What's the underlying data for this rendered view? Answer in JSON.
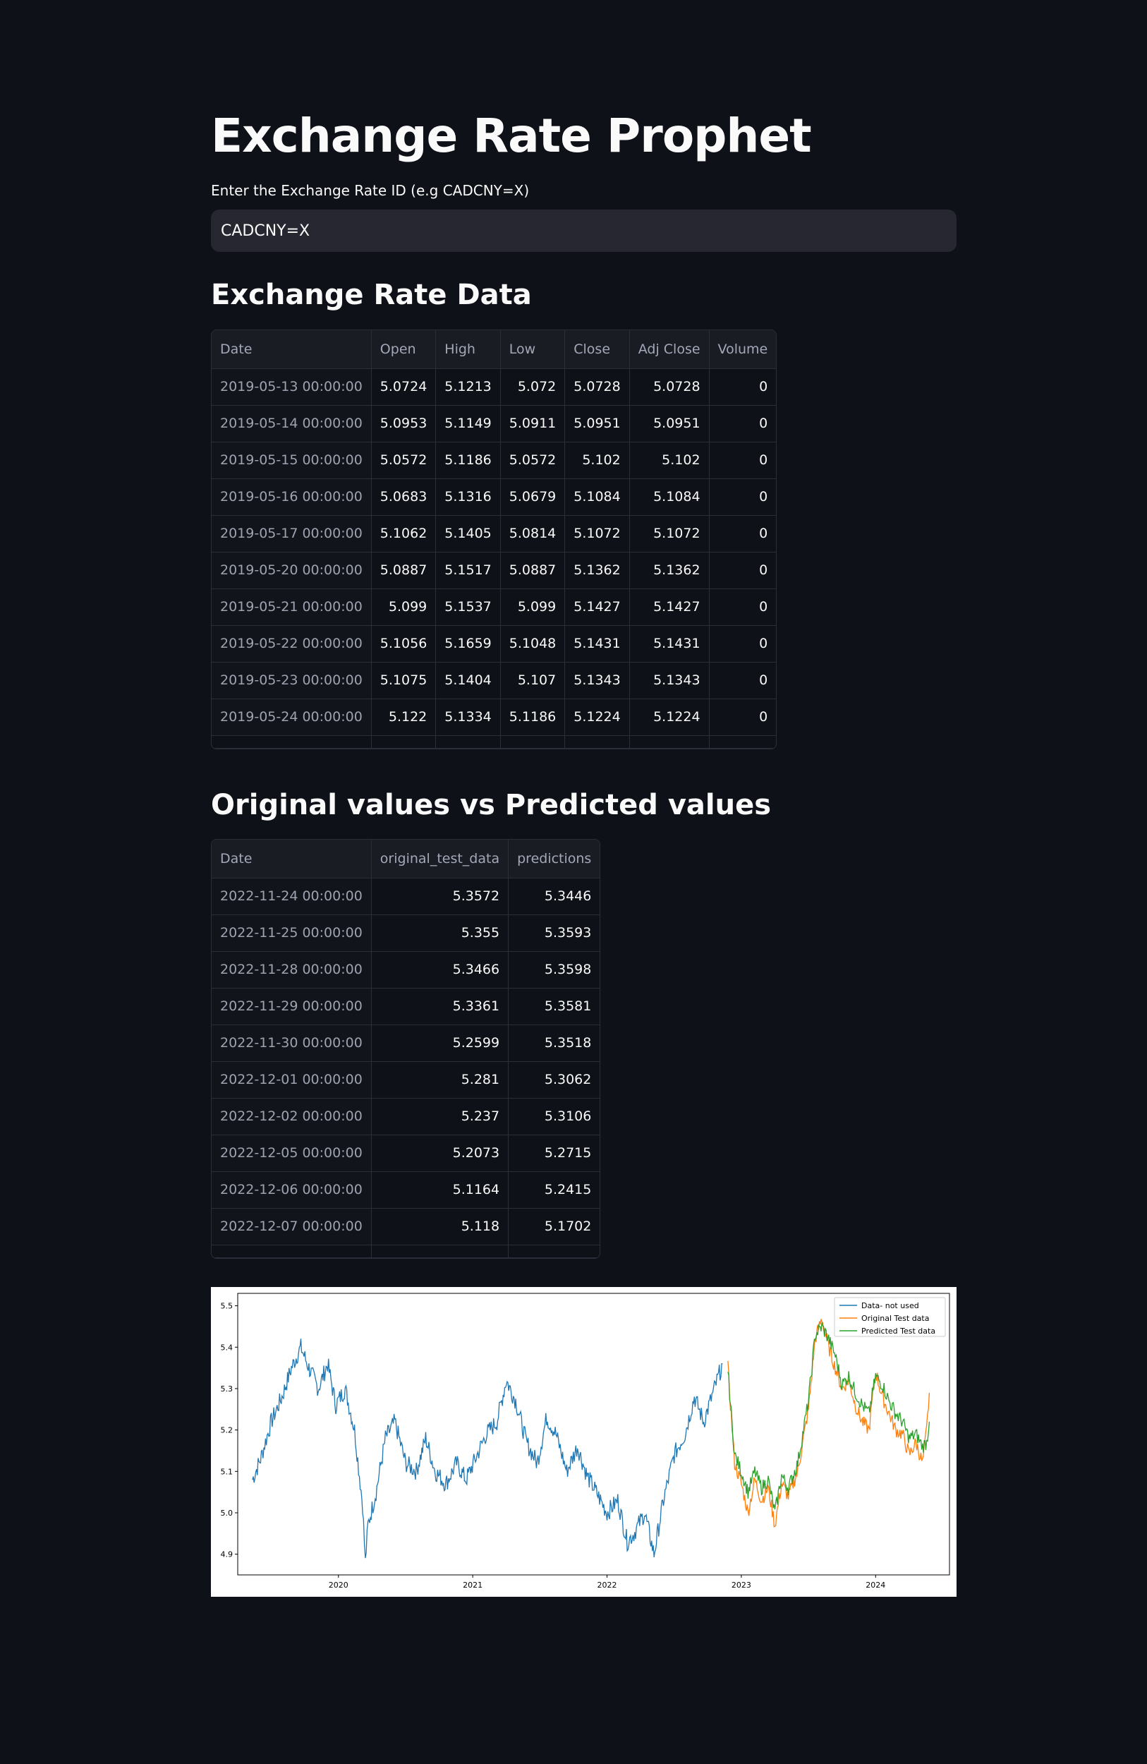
{
  "app": {
    "title": "Exchange Rate Prophet",
    "input_label": "Enter the Exchange Rate ID (e.g CADCNY=X)",
    "input_value": "CADCNY=X"
  },
  "exchange_section": {
    "heading": "Exchange Rate Data",
    "columns": [
      "Date",
      "Open",
      "High",
      "Low",
      "Close",
      "Adj Close",
      "Volume"
    ],
    "rows": [
      [
        "2019-05-13 00:00:00",
        "5.0724",
        "5.1213",
        "5.072",
        "5.0728",
        "5.0728",
        "0"
      ],
      [
        "2019-05-14 00:00:00",
        "5.0953",
        "5.1149",
        "5.0911",
        "5.0951",
        "5.0951",
        "0"
      ],
      [
        "2019-05-15 00:00:00",
        "5.0572",
        "5.1186",
        "5.0572",
        "5.102",
        "5.102",
        "0"
      ],
      [
        "2019-05-16 00:00:00",
        "5.0683",
        "5.1316",
        "5.0679",
        "5.1084",
        "5.1084",
        "0"
      ],
      [
        "2019-05-17 00:00:00",
        "5.1062",
        "5.1405",
        "5.0814",
        "5.1072",
        "5.1072",
        "0"
      ],
      [
        "2019-05-20 00:00:00",
        "5.0887",
        "5.1517",
        "5.0887",
        "5.1362",
        "5.1362",
        "0"
      ],
      [
        "2019-05-21 00:00:00",
        "5.099",
        "5.1537",
        "5.099",
        "5.1427",
        "5.1427",
        "0"
      ],
      [
        "2019-05-22 00:00:00",
        "5.1056",
        "5.1659",
        "5.1048",
        "5.1431",
        "5.1431",
        "0"
      ],
      [
        "2019-05-23 00:00:00",
        "5.1075",
        "5.1404",
        "5.107",
        "5.1343",
        "5.1343",
        "0"
      ],
      [
        "2019-05-24 00:00:00",
        "5.122",
        "5.1334",
        "5.1186",
        "5.1224",
        "5.1224",
        "0"
      ]
    ]
  },
  "prediction_section": {
    "heading": "Original values vs Predicted values",
    "columns": [
      "Date",
      "original_test_data",
      "predictions"
    ],
    "rows": [
      [
        "2022-11-24 00:00:00",
        "5.3572",
        "5.3446"
      ],
      [
        "2022-11-25 00:00:00",
        "5.355",
        "5.3593"
      ],
      [
        "2022-11-28 00:00:00",
        "5.3466",
        "5.3598"
      ],
      [
        "2022-11-29 00:00:00",
        "5.3361",
        "5.3581"
      ],
      [
        "2022-11-30 00:00:00",
        "5.2599",
        "5.3518"
      ],
      [
        "2022-12-01 00:00:00",
        "5.281",
        "5.3062"
      ],
      [
        "2022-12-02 00:00:00",
        "5.237",
        "5.3106"
      ],
      [
        "2022-12-05 00:00:00",
        "5.2073",
        "5.2715"
      ],
      [
        "2022-12-06 00:00:00",
        "5.1164",
        "5.2415"
      ],
      [
        "2022-12-07 00:00:00",
        "5.118",
        "5.1702"
      ]
    ]
  },
  "chart_data": {
    "type": "line",
    "title": "",
    "xlabel": "",
    "ylabel": "",
    "x_ticks": [
      "2020",
      "2021",
      "2022",
      "2023",
      "2024"
    ],
    "y_ticks": [
      "4.9",
      "5.0",
      "5.1",
      "5.2",
      "5.3",
      "5.4",
      "5.5"
    ],
    "xlim": [
      2019.25,
      2024.55
    ],
    "ylim": [
      4.85,
      5.53
    ],
    "grid": false,
    "legend_position": "top-right",
    "series": [
      {
        "name": "Data- not used",
        "color": "#1f77b4",
        "x": [
          2019.36,
          2019.42,
          2019.5,
          2019.58,
          2019.65,
          2019.72,
          2019.78,
          2019.85,
          2019.92,
          2019.98,
          2020.05,
          2020.12,
          2020.18,
          2020.2,
          2020.22,
          2020.28,
          2020.35,
          2020.42,
          2020.5,
          2020.58,
          2020.65,
          2020.72,
          2020.8,
          2020.88,
          2020.95,
          2021.02,
          2021.1,
          2021.18,
          2021.25,
          2021.32,
          2021.4,
          2021.48,
          2021.55,
          2021.62,
          2021.7,
          2021.78,
          2021.85,
          2021.92,
          2022.0,
          2022.08,
          2022.15,
          2022.2,
          2022.28,
          2022.35,
          2022.42,
          2022.5,
          2022.58,
          2022.65,
          2022.72,
          2022.8,
          2022.86
        ],
        "y": [
          5.08,
          5.13,
          5.22,
          5.28,
          5.35,
          5.4,
          5.35,
          5.3,
          5.36,
          5.26,
          5.3,
          5.2,
          5.02,
          4.88,
          4.97,
          5.05,
          5.18,
          5.22,
          5.12,
          5.1,
          5.18,
          5.1,
          5.07,
          5.12,
          5.08,
          5.13,
          5.19,
          5.22,
          5.32,
          5.27,
          5.17,
          5.12,
          5.23,
          5.19,
          5.1,
          5.16,
          5.09,
          5.05,
          5.0,
          5.03,
          4.93,
          4.95,
          5.0,
          4.9,
          5.03,
          5.14,
          5.19,
          5.28,
          5.22,
          5.3,
          5.36
        ]
      },
      {
        "name": "Original Test data",
        "color": "#ff7f0e",
        "x": [
          2022.9,
          2022.95,
          2023.0,
          2023.05,
          2023.1,
          2023.15,
          2023.2,
          2023.25,
          2023.3,
          2023.35,
          2023.42,
          2023.5,
          2023.55,
          2023.6,
          2023.65,
          2023.7,
          2023.75,
          2023.8,
          2023.85,
          2023.9,
          2023.95,
          2024.0,
          2024.05,
          2024.1,
          2024.15,
          2024.2,
          2024.25,
          2024.3,
          2024.35,
          2024.38,
          2024.4
        ],
        "y": [
          5.35,
          5.12,
          5.07,
          5.0,
          5.08,
          5.03,
          5.06,
          4.97,
          5.07,
          5.04,
          5.1,
          5.25,
          5.42,
          5.47,
          5.4,
          5.35,
          5.3,
          5.32,
          5.26,
          5.22,
          5.2,
          5.34,
          5.28,
          5.24,
          5.2,
          5.19,
          5.14,
          5.17,
          5.12,
          5.2,
          5.29
        ]
      },
      {
        "name": "Predicted Test data",
        "color": "#2ca02c",
        "x": [
          2022.9,
          2022.95,
          2023.0,
          2023.05,
          2023.1,
          2023.15,
          2023.2,
          2023.25,
          2023.3,
          2023.35,
          2023.42,
          2023.5,
          2023.55,
          2023.6,
          2023.65,
          2023.7,
          2023.75,
          2023.8,
          2023.85,
          2023.9,
          2023.95,
          2024.0,
          2024.05,
          2024.1,
          2024.15,
          2024.2,
          2024.25,
          2024.3,
          2024.35,
          2024.38,
          2024.4
        ],
        "y": [
          5.34,
          5.14,
          5.1,
          5.05,
          5.1,
          5.06,
          5.08,
          5.0,
          5.09,
          5.06,
          5.12,
          5.27,
          5.43,
          5.45,
          5.42,
          5.38,
          5.31,
          5.33,
          5.29,
          5.26,
          5.24,
          5.33,
          5.31,
          5.27,
          5.24,
          5.22,
          5.18,
          5.19,
          5.16,
          5.17,
          5.22
        ]
      }
    ]
  }
}
